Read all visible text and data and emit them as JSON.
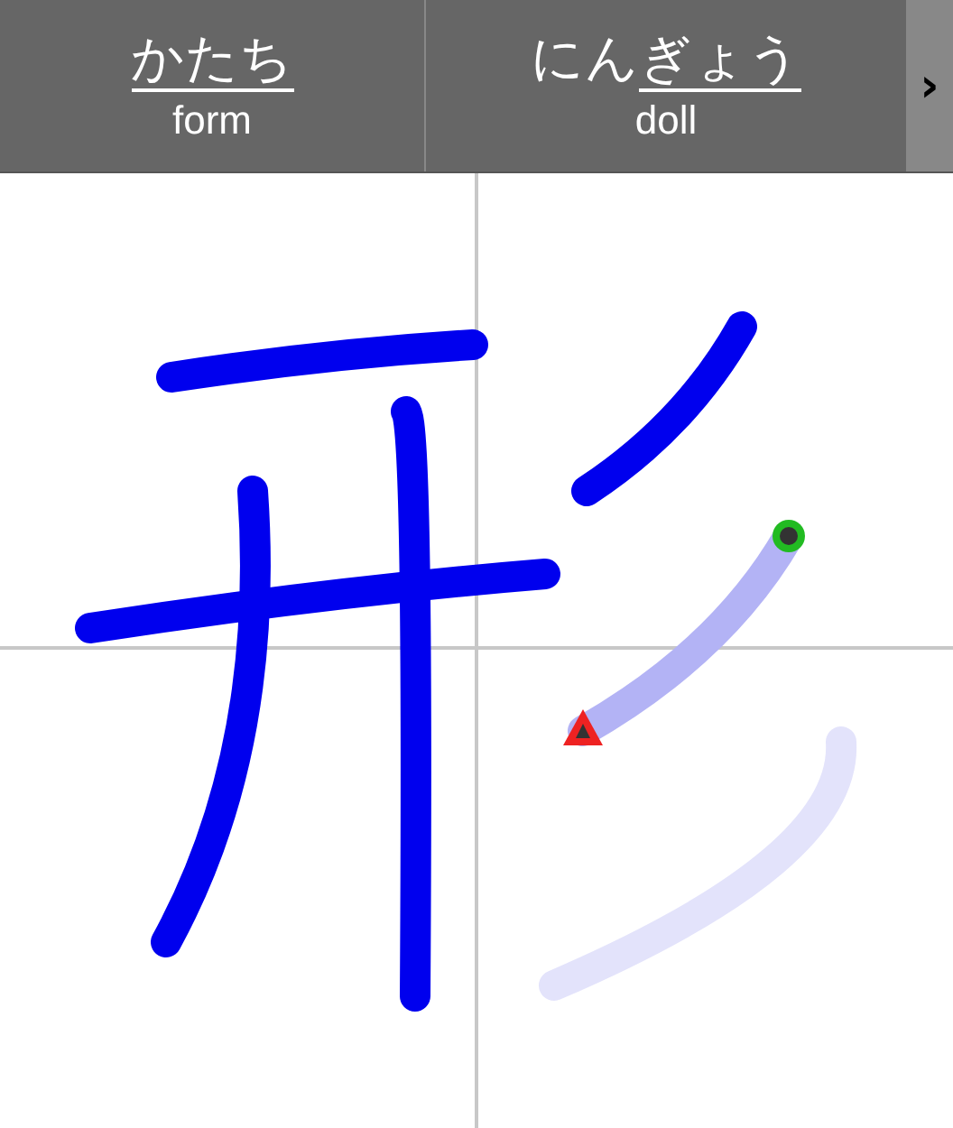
{
  "words": [
    {
      "reading": [
        {
          "text": "かたち",
          "underlined": true
        }
      ],
      "meaning": "form"
    },
    {
      "reading": [
        {
          "text": "にん",
          "underlined": false
        },
        {
          "text": "ぎょう",
          "underlined": true
        }
      ],
      "meaning": "doll"
    }
  ],
  "next_button": {
    "label": "›"
  },
  "strokes": [
    {
      "drawn": true,
      "current": false
    },
    {
      "drawn": true,
      "current": false
    },
    {
      "drawn": true,
      "current": false
    },
    {
      "drawn": true,
      "current": false
    },
    {
      "drawn": true,
      "current": false
    },
    {
      "drawn": false,
      "current": true
    },
    {
      "drawn": false,
      "current": false
    }
  ]
}
